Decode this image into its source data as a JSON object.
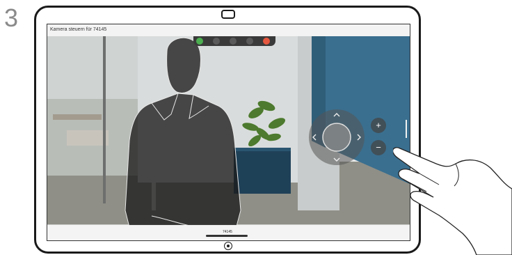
{
  "step": {
    "number": "3"
  },
  "screen": {
    "title": "Kamera steuern für 74145",
    "pip_label": "74145"
  },
  "camera_control": {
    "zoom_in": "+",
    "zoom_out": "−"
  },
  "colors": {
    "end_call": "#e5573f",
    "accept": "#4caf50",
    "wall_blue": "#3a6f8f",
    "person_overlay": "#1c1c1c"
  },
  "icons": [
    "home-button-icon",
    "front-camera-icon",
    "chevron-up-icon",
    "chevron-down-icon",
    "chevron-left-icon",
    "chevron-right-icon",
    "plus-icon",
    "minus-icon",
    "pointing-hand-icon"
  ]
}
